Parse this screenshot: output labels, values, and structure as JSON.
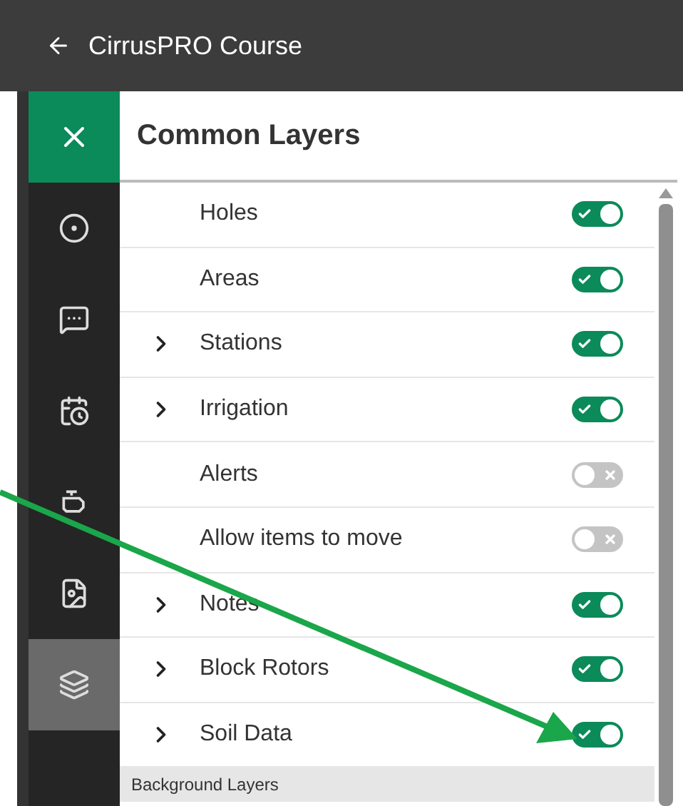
{
  "header": {
    "title": "CirrusPRO Course"
  },
  "sidebar": {
    "items": [
      {
        "selected": false
      },
      {
        "selected": false
      },
      {
        "selected": false
      },
      {
        "selected": false
      },
      {
        "selected": false
      },
      {
        "selected": true
      }
    ]
  },
  "panel": {
    "title": "Common Layers",
    "layers": [
      {
        "label": "Holes",
        "expandable": false,
        "on": true
      },
      {
        "label": "Areas",
        "expandable": false,
        "on": true
      },
      {
        "label": "Stations",
        "expandable": true,
        "on": true
      },
      {
        "label": "Irrigation",
        "expandable": true,
        "on": true
      },
      {
        "label": "Alerts",
        "expandable": false,
        "on": false
      },
      {
        "label": "Allow items to move",
        "expandable": false,
        "on": false
      },
      {
        "label": "Notes",
        "expandable": true,
        "on": true
      },
      {
        "label": "Block Rotors",
        "expandable": true,
        "on": true
      },
      {
        "label": "Soil Data",
        "expandable": true,
        "on": true
      }
    ],
    "section": "Background Layers"
  }
}
